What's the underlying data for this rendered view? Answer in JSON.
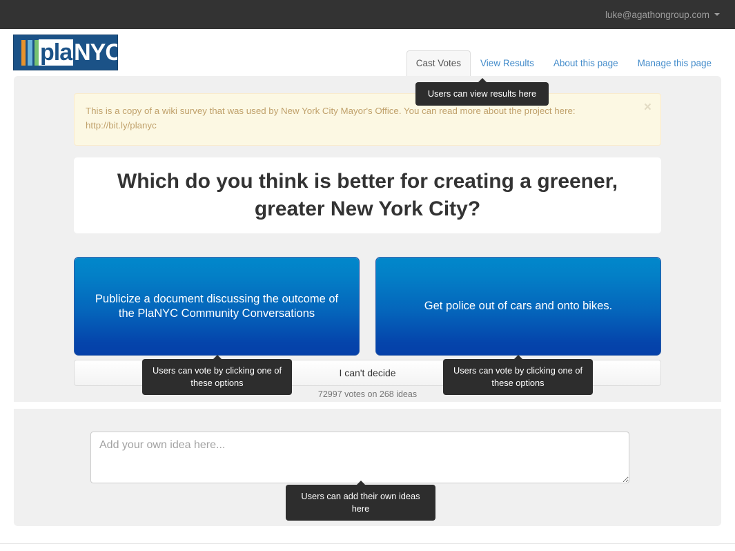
{
  "topbar": {
    "user_email": "luke@agathongroup.com",
    "caret_icon": "chevron-down-icon"
  },
  "header": {
    "logo": {
      "text_primary": "pla",
      "text_secondary": "NYC",
      "alt": "plaNYC logo",
      "background_color": "#1b5287",
      "stripe_colors": [
        "#e8932c",
        "#6cb6dd",
        "#77c272"
      ]
    },
    "tabs": [
      {
        "label": "Cast Votes",
        "active": true
      },
      {
        "label": "View Results",
        "active": false
      },
      {
        "label": "About this page",
        "active": false
      },
      {
        "label": "Manage this page",
        "active": false
      }
    ]
  },
  "alert": {
    "message": "This is a copy of a wiki survey that was used by New York City Mayor's Office. You can read more about the project here: http://bit.ly/planyc",
    "close_label": "×",
    "background_color": "#fcf8e3",
    "text_color": "#c0a16b"
  },
  "survey": {
    "question": "Which do you think is better for creating a greener, greater New York City?",
    "options": [
      {
        "id": "left",
        "label": "Publicize a document discussing the outcome of the PlaNYC Community Conversations"
      },
      {
        "id": "right",
        "label": "Get police out of cars and onto bikes."
      }
    ],
    "cant_decide_label": "I can't decide",
    "vote_count_text": "72997 votes on 268 ideas",
    "votes": 72997,
    "ideas": 268,
    "option_gradient_top": "#0288cb",
    "option_gradient_bottom": "#0540a9"
  },
  "idea_form": {
    "placeholder": "Add your own idea here...",
    "value": ""
  },
  "tooltips": {
    "view_results": "Users can view results here",
    "vote_left": "Users can vote by clicking one of these options",
    "vote_right": "Users can vote by clicking one of these options",
    "add_idea": "Users can add their own ideas here",
    "background_color": "#2d2d2d"
  }
}
